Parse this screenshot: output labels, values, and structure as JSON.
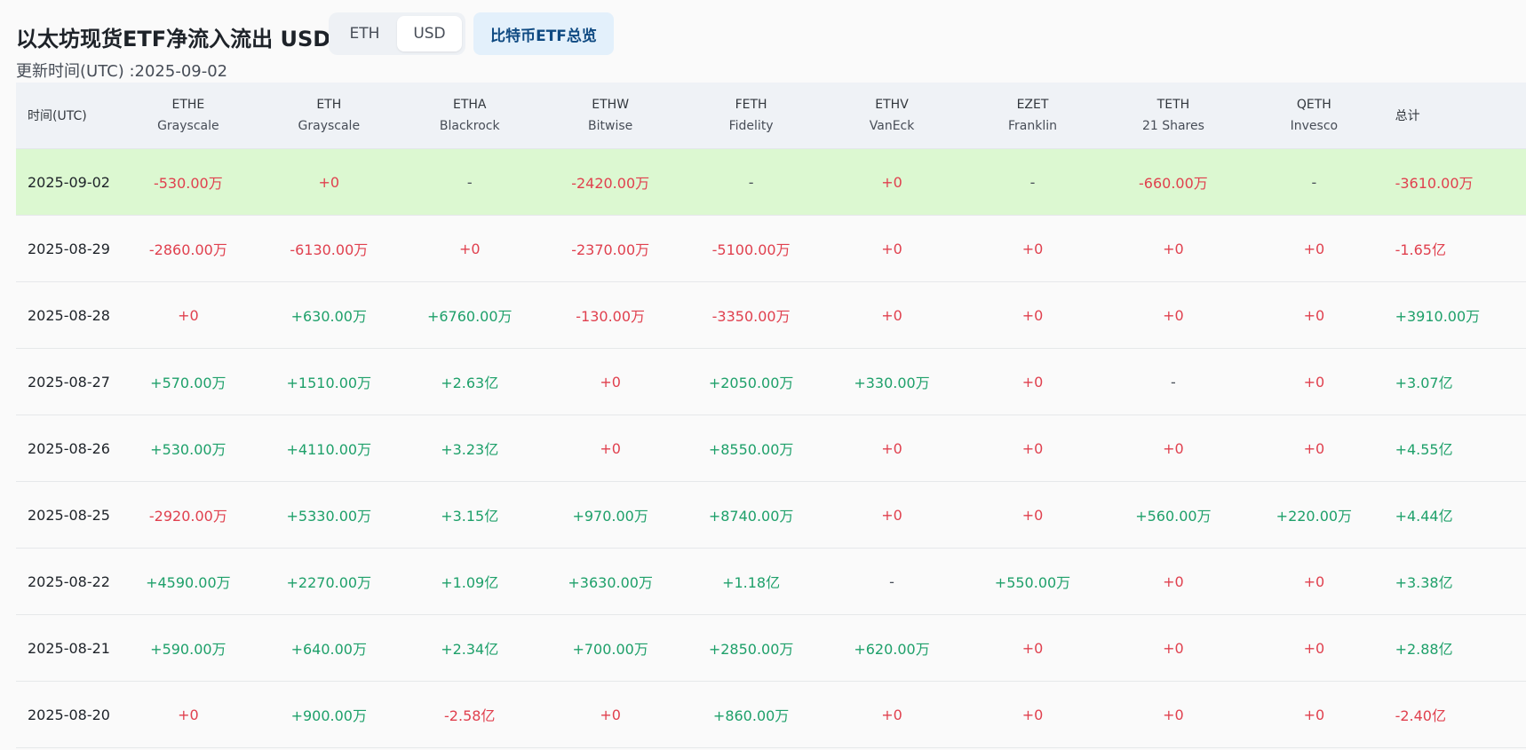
{
  "header": {
    "title": "以太坊现货ETF净流入流出 USD",
    "toggle": [
      "ETH",
      "USD"
    ],
    "active_toggle": "USD",
    "overview_button": "比特币ETF总览",
    "update_time": "更新时间(UTC) :2025-09-02"
  },
  "table": {
    "date_header": "时间(UTC)",
    "total_header": "总计",
    "columns": [
      {
        "ticker": "ETHE",
        "issuer": "Grayscale"
      },
      {
        "ticker": "ETH",
        "issuer": "Grayscale"
      },
      {
        "ticker": "ETHA",
        "issuer": "Blackrock"
      },
      {
        "ticker": "ETHW",
        "issuer": "Bitwise"
      },
      {
        "ticker": "FETH",
        "issuer": "Fidelity"
      },
      {
        "ticker": "ETHV",
        "issuer": "VanEck"
      },
      {
        "ticker": "EZET",
        "issuer": "Franklin"
      },
      {
        "ticker": "TETH",
        "issuer": "21 Shares"
      },
      {
        "ticker": "QETH",
        "issuer": "Invesco"
      }
    ],
    "rows": [
      {
        "date": "2025-09-02",
        "highlight": true,
        "values": [
          "-530.00万",
          "+0",
          "-",
          "-2420.00万",
          "-",
          "+0",
          "-",
          "-660.00万",
          "-"
        ],
        "total": "-3610.00万"
      },
      {
        "date": "2025-08-29",
        "highlight": false,
        "values": [
          "-2860.00万",
          "-6130.00万",
          "+0",
          "-2370.00万",
          "-5100.00万",
          "+0",
          "+0",
          "+0",
          "+0"
        ],
        "total": "-1.65亿"
      },
      {
        "date": "2025-08-28",
        "highlight": false,
        "values": [
          "+0",
          "+630.00万",
          "+6760.00万",
          "-130.00万",
          "-3350.00万",
          "+0",
          "+0",
          "+0",
          "+0"
        ],
        "total": "+3910.00万"
      },
      {
        "date": "2025-08-27",
        "highlight": false,
        "values": [
          "+570.00万",
          "+1510.00万",
          "+2.63亿",
          "+0",
          "+2050.00万",
          "+330.00万",
          "+0",
          "-",
          "+0"
        ],
        "total": "+3.07亿"
      },
      {
        "date": "2025-08-26",
        "highlight": false,
        "values": [
          "+530.00万",
          "+4110.00万",
          "+3.23亿",
          "+0",
          "+8550.00万",
          "+0",
          "+0",
          "+0",
          "+0"
        ],
        "total": "+4.55亿"
      },
      {
        "date": "2025-08-25",
        "highlight": false,
        "values": [
          "-2920.00万",
          "+5330.00万",
          "+3.15亿",
          "+970.00万",
          "+8740.00万",
          "+0",
          "+0",
          "+560.00万",
          "+220.00万"
        ],
        "total": "+4.44亿"
      },
      {
        "date": "2025-08-22",
        "highlight": false,
        "values": [
          "+4590.00万",
          "+2270.00万",
          "+1.09亿",
          "+3630.00万",
          "+1.18亿",
          "-",
          "+550.00万",
          "+0",
          "+0"
        ],
        "total": "+3.38亿"
      },
      {
        "date": "2025-08-21",
        "highlight": false,
        "values": [
          "+590.00万",
          "+640.00万",
          "+2.34亿",
          "+700.00万",
          "+2850.00万",
          "+620.00万",
          "+0",
          "+0",
          "+0"
        ],
        "total": "+2.88亿"
      },
      {
        "date": "2025-08-20",
        "highlight": false,
        "values": [
          "+0",
          "+900.00万",
          "-2.58亿",
          "+0",
          "+860.00万",
          "+0",
          "+0",
          "+0",
          "+0"
        ],
        "total": "-2.40亿"
      }
    ]
  },
  "colors": {
    "positive": "#1ea06a",
    "negative": "#e0404e",
    "neutral": "#474d57",
    "highlight_row": "#dcf8d1",
    "header_bg": "#eff2f6",
    "overview_bg": "#e3f0fb",
    "overview_text": "#0f4a82"
  }
}
